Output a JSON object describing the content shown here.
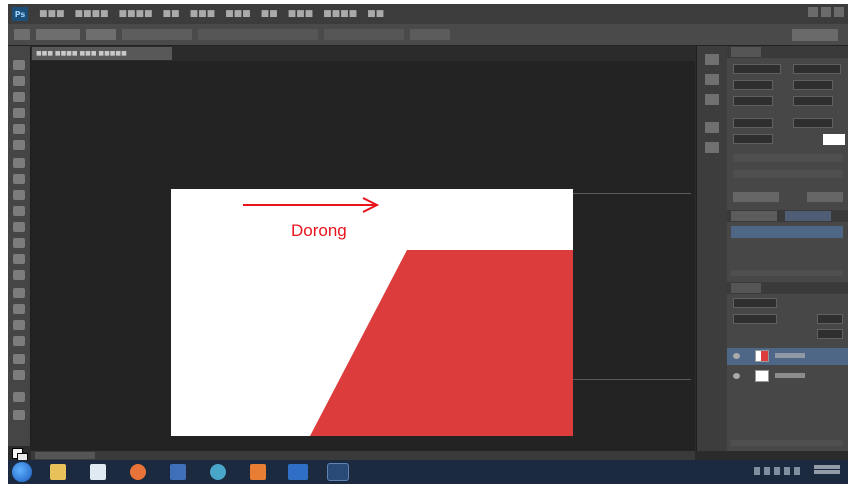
{
  "annotation": {
    "label": "Dorong",
    "color": "#e8141c",
    "arrow": "right-arrow"
  },
  "colors": {
    "shape_fill": "#dd3c3c",
    "document_background": "#ffffff",
    "workspace_background": "#232323",
    "panel_background": "#474747",
    "taskbar_background": "#1b2a3f"
  },
  "app": {
    "logo": "Ps"
  },
  "taskbar": {
    "icons": [
      "windows-start-icon",
      "explorer-icon",
      "media-icon",
      "firefox-icon",
      "mail-icon",
      "chrome-icon",
      "paint-icon",
      "word-icon",
      "photoshop-icon"
    ]
  }
}
